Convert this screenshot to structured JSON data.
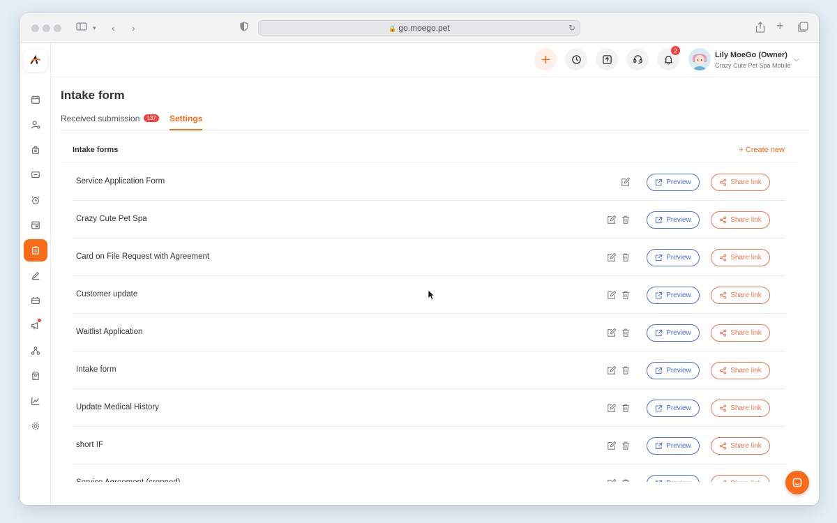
{
  "browser": {
    "url": "go.moego.pet"
  },
  "colors": {
    "accent": "#f96b18",
    "preview_blue": "#4a6fd8",
    "share_orange": "#f0764e",
    "badge_red": "#f04040"
  },
  "sidebar": {
    "items": [
      {
        "id": "calendar",
        "icon": "calendar-icon"
      },
      {
        "id": "clients",
        "icon": "user-settings-icon"
      },
      {
        "id": "lodging",
        "icon": "bag-icon"
      },
      {
        "id": "messages",
        "icon": "message-icon"
      },
      {
        "id": "reminders",
        "icon": "alarm-icon"
      },
      {
        "id": "reports",
        "icon": "table-icon"
      },
      {
        "id": "intake-forms",
        "icon": "clipboard-icon",
        "active": true
      },
      {
        "id": "agreements",
        "icon": "pen-icon"
      },
      {
        "id": "payroll",
        "icon": "ticket-icon"
      },
      {
        "id": "marketing",
        "icon": "megaphone-icon",
        "dot": true
      },
      {
        "id": "network",
        "icon": "network-icon"
      },
      {
        "id": "retail",
        "icon": "shopping-bag-icon"
      },
      {
        "id": "insights",
        "icon": "chart-line-icon"
      },
      {
        "id": "settings",
        "icon": "gear-icon"
      }
    ]
  },
  "header": {
    "notifications_count": "2",
    "user": {
      "name": "Lily MoeGo (Owner)",
      "business": "Crazy Cute Pet Spa Mobile"
    }
  },
  "page": {
    "title": "Intake form",
    "tabs": [
      {
        "label": "Received submission",
        "count": "137"
      },
      {
        "label": "Settings",
        "active": true
      }
    ]
  },
  "forms_card": {
    "title": "Intake forms",
    "create_label": "+ Create new",
    "preview_label": "Preview",
    "share_label": "Share link",
    "rows": [
      {
        "name": "Service Application Form",
        "deletable": false
      },
      {
        "name": "Crazy Cute Pet Spa",
        "deletable": true
      },
      {
        "name": "Card on File Request with Agreement",
        "deletable": true
      },
      {
        "name": "Customer update",
        "deletable": true
      },
      {
        "name": "Waitlist Application",
        "deletable": true
      },
      {
        "name": "Intake form",
        "deletable": true
      },
      {
        "name": "Update Medical History",
        "deletable": true
      },
      {
        "name": "short IF",
        "deletable": true
      },
      {
        "name": "Service Agreement (cropped)",
        "deletable": true
      }
    ]
  }
}
